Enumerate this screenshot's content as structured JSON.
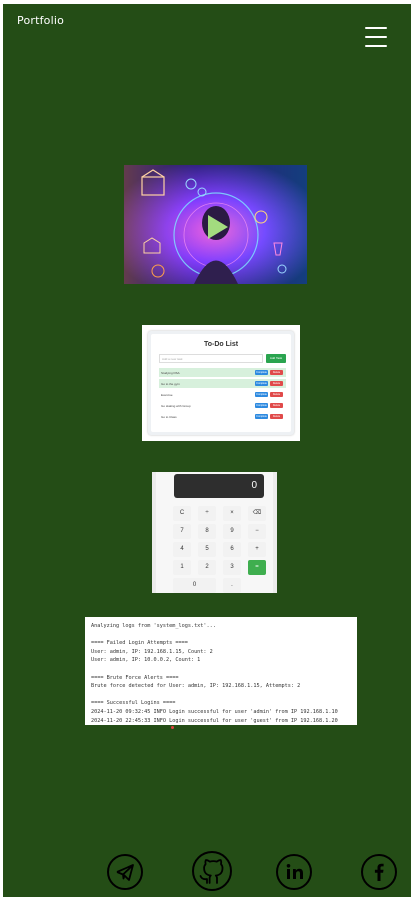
{
  "header": {
    "brand": "Portfolio",
    "menu_icon": "hamburger-menu-icon"
  },
  "projects": {
    "ai_video": {
      "icon": "play-icon"
    },
    "todo": {
      "title": "To-Do List",
      "input_placeholder": "Add a new task",
      "add_label": "Add Task",
      "items": [
        {
          "text": "Studying DSA",
          "done": true
        },
        {
          "text": "Go to the gym",
          "done": true
        },
        {
          "text": "Exercise",
          "done": false
        },
        {
          "text": "Go skating with Group",
          "done": false
        },
        {
          "text": "Go to Class",
          "done": false
        }
      ],
      "complete_label": "Complete",
      "delete_label": "Delete"
    },
    "calculator": {
      "display": "0",
      "keys": [
        "C",
        "÷",
        "×",
        "⌫",
        "7",
        "8",
        "9",
        "−",
        "4",
        "5",
        "6",
        "+",
        "1",
        "2",
        "3",
        "=",
        "0",
        "."
      ]
    },
    "log_analyzer": {
      "lines": [
        "Analyzing logs from 'system_logs.txt'...",
        "",
        "==== Failed Login Attempts ====",
        "User: admin, IP: 192.168.1.15, Count: 2",
        "User: admin, IP: 10.0.0.2, Count: 1",
        "",
        "==== Brute Force Alerts ====",
        "Brute force detected for User: admin, IP: 192.168.1.15, Attempts: 2",
        "",
        "==== Successful Logins ====",
        "2024-11-20 09:32:45 INFO Login successful for user 'admin' from IP 192.168.1.10",
        "2024-11-20 22:45:33 INFO Login successful for user 'guest' from IP 192.168.1.20"
      ]
    }
  },
  "socials": [
    {
      "name": "telegram",
      "icon": "telegram-icon"
    },
    {
      "name": "github",
      "icon": "github-icon"
    },
    {
      "name": "linkedin",
      "icon": "linkedin-icon"
    },
    {
      "name": "facebook",
      "icon": "facebook-icon"
    }
  ],
  "colors": {
    "background": "#244d16",
    "accent_green": "#2aa44f"
  }
}
